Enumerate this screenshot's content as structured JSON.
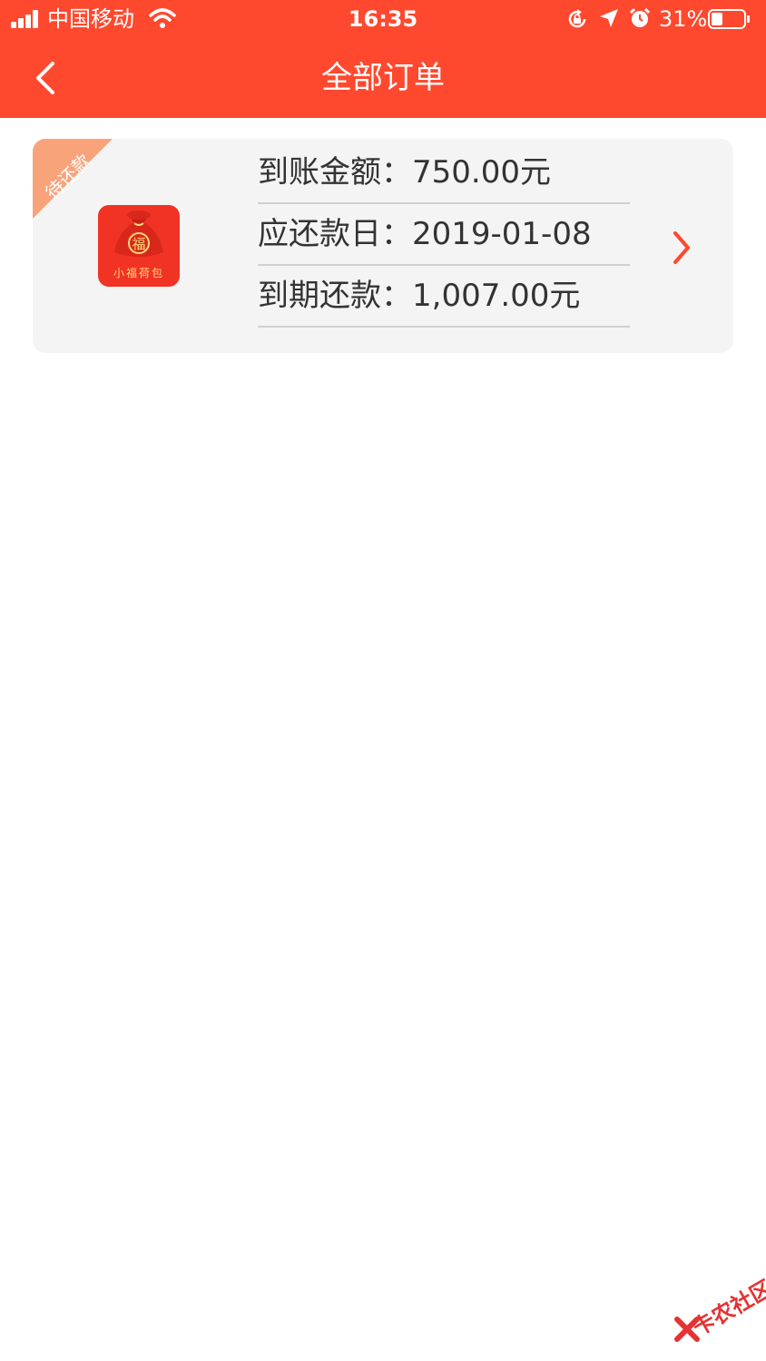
{
  "status_bar": {
    "carrier": "中国移动",
    "time": "16:35",
    "battery": "31%"
  },
  "header": {
    "title": "全部订单"
  },
  "order": {
    "status_ribbon": "待还款",
    "app_name": "小福荷包",
    "logo_char": "福",
    "rows": [
      {
        "label": "到账金额：",
        "value": "750.00元"
      },
      {
        "label": "应还款日：",
        "value": "2019-01-08"
      },
      {
        "label": "到期还款：",
        "value": "1,007.00元"
      }
    ]
  },
  "watermark": {
    "text": "卡农社区"
  },
  "colors": {
    "brand": "#fe492f",
    "ribbon": "#f9a37b",
    "card_bg": "#f4f4f4"
  }
}
